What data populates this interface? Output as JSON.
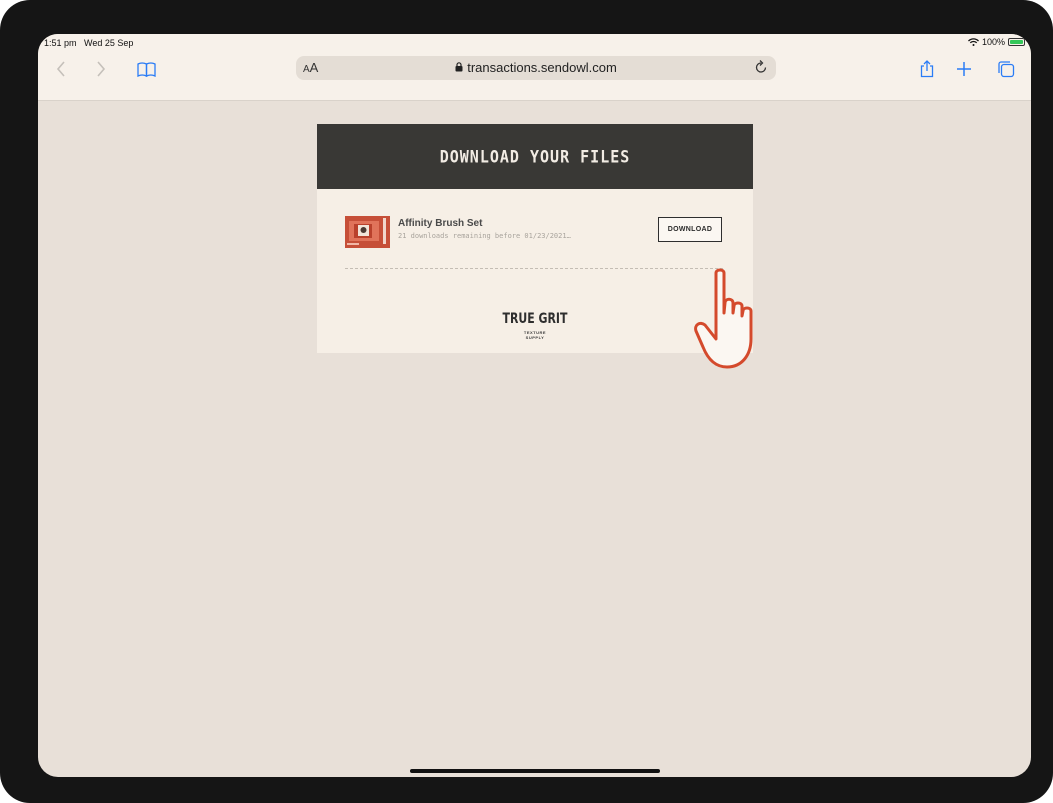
{
  "status": {
    "time": "1:51 pm",
    "date": "Wed 25 Sep",
    "battery": "100%",
    "battery_level": 1.0
  },
  "browser": {
    "text_size_label_small": "A",
    "text_size_label_large": "A",
    "url": "transactions.sendowl.com",
    "icons": [
      "back-icon",
      "forward-icon",
      "bookmarks-icon",
      "lock-icon",
      "reload-icon",
      "share-icon",
      "new-tab-icon",
      "tabs-icon"
    ]
  },
  "page": {
    "header_title": "DOWNLOAD YOUR FILES",
    "item": {
      "name": "Affinity Brush Set",
      "subtitle": "21 downloads remaining before 01/23/2021…",
      "button_label": "DOWNLOAD"
    },
    "logo": {
      "title": "TRUE GRIT",
      "line1": "TEXTURE",
      "line2": "SUPPLY"
    }
  },
  "colors": {
    "accent_blue": "#2a7cf6",
    "header_bg": "#393835",
    "card_bg": "#f6efe6",
    "thumb_red": "#c64f38",
    "hand_outline": "#d44a2c"
  }
}
